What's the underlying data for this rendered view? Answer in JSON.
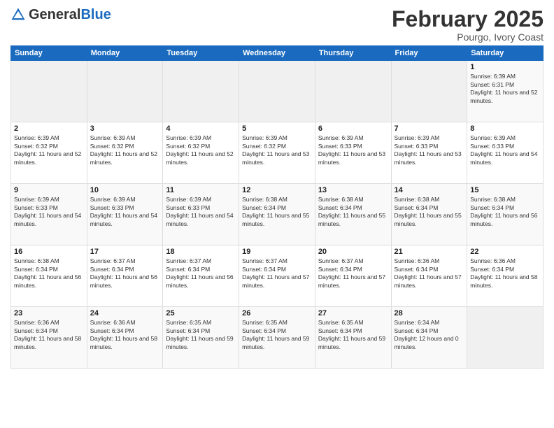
{
  "header": {
    "logo_general": "General",
    "logo_blue": "Blue",
    "month_title": "February 2025",
    "subtitle": "Pourgo, Ivory Coast"
  },
  "days_of_week": [
    "Sunday",
    "Monday",
    "Tuesday",
    "Wednesday",
    "Thursday",
    "Friday",
    "Saturday"
  ],
  "weeks": [
    [
      {
        "day": "",
        "info": ""
      },
      {
        "day": "",
        "info": ""
      },
      {
        "day": "",
        "info": ""
      },
      {
        "day": "",
        "info": ""
      },
      {
        "day": "",
        "info": ""
      },
      {
        "day": "",
        "info": ""
      },
      {
        "day": "1",
        "info": "Sunrise: 6:39 AM\nSunset: 6:31 PM\nDaylight: 11 hours and 52 minutes."
      }
    ],
    [
      {
        "day": "2",
        "info": "Sunrise: 6:39 AM\nSunset: 6:32 PM\nDaylight: 11 hours and 52 minutes."
      },
      {
        "day": "3",
        "info": "Sunrise: 6:39 AM\nSunset: 6:32 PM\nDaylight: 11 hours and 52 minutes."
      },
      {
        "day": "4",
        "info": "Sunrise: 6:39 AM\nSunset: 6:32 PM\nDaylight: 11 hours and 52 minutes."
      },
      {
        "day": "5",
        "info": "Sunrise: 6:39 AM\nSunset: 6:32 PM\nDaylight: 11 hours and 53 minutes."
      },
      {
        "day": "6",
        "info": "Sunrise: 6:39 AM\nSunset: 6:33 PM\nDaylight: 11 hours and 53 minutes."
      },
      {
        "day": "7",
        "info": "Sunrise: 6:39 AM\nSunset: 6:33 PM\nDaylight: 11 hours and 53 minutes."
      },
      {
        "day": "8",
        "info": "Sunrise: 6:39 AM\nSunset: 6:33 PM\nDaylight: 11 hours and 54 minutes."
      }
    ],
    [
      {
        "day": "9",
        "info": "Sunrise: 6:39 AM\nSunset: 6:33 PM\nDaylight: 11 hours and 54 minutes."
      },
      {
        "day": "10",
        "info": "Sunrise: 6:39 AM\nSunset: 6:33 PM\nDaylight: 11 hours and 54 minutes."
      },
      {
        "day": "11",
        "info": "Sunrise: 6:39 AM\nSunset: 6:33 PM\nDaylight: 11 hours and 54 minutes."
      },
      {
        "day": "12",
        "info": "Sunrise: 6:38 AM\nSunset: 6:34 PM\nDaylight: 11 hours and 55 minutes."
      },
      {
        "day": "13",
        "info": "Sunrise: 6:38 AM\nSunset: 6:34 PM\nDaylight: 11 hours and 55 minutes."
      },
      {
        "day": "14",
        "info": "Sunrise: 6:38 AM\nSunset: 6:34 PM\nDaylight: 11 hours and 55 minutes."
      },
      {
        "day": "15",
        "info": "Sunrise: 6:38 AM\nSunset: 6:34 PM\nDaylight: 11 hours and 56 minutes."
      }
    ],
    [
      {
        "day": "16",
        "info": "Sunrise: 6:38 AM\nSunset: 6:34 PM\nDaylight: 11 hours and 56 minutes."
      },
      {
        "day": "17",
        "info": "Sunrise: 6:37 AM\nSunset: 6:34 PM\nDaylight: 11 hours and 56 minutes."
      },
      {
        "day": "18",
        "info": "Sunrise: 6:37 AM\nSunset: 6:34 PM\nDaylight: 11 hours and 56 minutes."
      },
      {
        "day": "19",
        "info": "Sunrise: 6:37 AM\nSunset: 6:34 PM\nDaylight: 11 hours and 57 minutes."
      },
      {
        "day": "20",
        "info": "Sunrise: 6:37 AM\nSunset: 6:34 PM\nDaylight: 11 hours and 57 minutes."
      },
      {
        "day": "21",
        "info": "Sunrise: 6:36 AM\nSunset: 6:34 PM\nDaylight: 11 hours and 57 minutes."
      },
      {
        "day": "22",
        "info": "Sunrise: 6:36 AM\nSunset: 6:34 PM\nDaylight: 11 hours and 58 minutes."
      }
    ],
    [
      {
        "day": "23",
        "info": "Sunrise: 6:36 AM\nSunset: 6:34 PM\nDaylight: 11 hours and 58 minutes."
      },
      {
        "day": "24",
        "info": "Sunrise: 6:36 AM\nSunset: 6:34 PM\nDaylight: 11 hours and 58 minutes."
      },
      {
        "day": "25",
        "info": "Sunrise: 6:35 AM\nSunset: 6:34 PM\nDaylight: 11 hours and 59 minutes."
      },
      {
        "day": "26",
        "info": "Sunrise: 6:35 AM\nSunset: 6:34 PM\nDaylight: 11 hours and 59 minutes."
      },
      {
        "day": "27",
        "info": "Sunrise: 6:35 AM\nSunset: 6:34 PM\nDaylight: 11 hours and 59 minutes."
      },
      {
        "day": "28",
        "info": "Sunrise: 6:34 AM\nSunset: 6:34 PM\nDaylight: 12 hours and 0 minutes."
      },
      {
        "day": "",
        "info": ""
      }
    ]
  ]
}
